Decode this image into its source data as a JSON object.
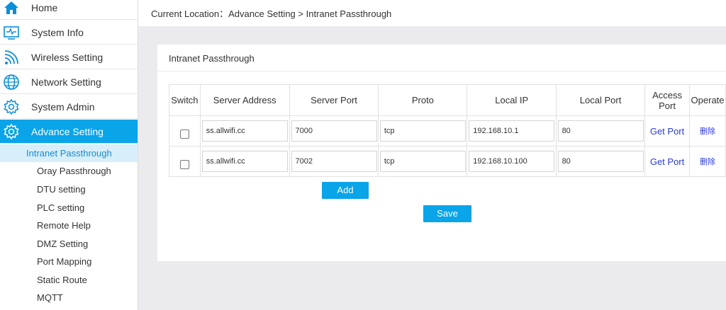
{
  "sidebar": {
    "items": [
      {
        "label": "Home",
        "icon": "home-icon"
      },
      {
        "label": "System Info",
        "icon": "monitor-icon"
      },
      {
        "label": "Wireless Setting",
        "icon": "wifi-icon"
      },
      {
        "label": "Network Setting",
        "icon": "globe-icon"
      },
      {
        "label": "System Admin",
        "icon": "gear-icon"
      },
      {
        "label": "Advance Setting",
        "icon": "gear-icon",
        "active": true
      }
    ],
    "sub_items": [
      {
        "label": "Intranet Passthrough",
        "active": true
      },
      {
        "label": "Oray Passthrough"
      },
      {
        "label": "DTU setting"
      },
      {
        "label": "PLC setting"
      },
      {
        "label": "Remote Help"
      },
      {
        "label": "DMZ Setting"
      },
      {
        "label": "Port Mapping"
      },
      {
        "label": "Static Route"
      },
      {
        "label": "MQTT"
      }
    ]
  },
  "breadcrumb": "Current Location：Advance Setting > Intranet Passthrough",
  "card": {
    "title": "Intranet Passthrough",
    "columns": {
      "switch": "Switch",
      "server_address": "Server Address",
      "server_port": "Server Port",
      "proto": "Proto",
      "local_ip": "Local IP",
      "local_port": "Local Port",
      "access_port_1": "Access",
      "access_port_2": "Port",
      "operate": "Operate"
    },
    "rows": [
      {
        "switch": false,
        "server_address": "ss.allwifi.cc",
        "server_port": "7000",
        "proto": "tcp",
        "local_ip": "192.168.10.1",
        "local_port": "80",
        "access": "Get Port",
        "operate": "删除"
      },
      {
        "switch": false,
        "server_address": "ss.allwifi.cc",
        "server_port": "7002",
        "proto": "tcp",
        "local_ip": "192.168.10.100",
        "local_port": "80",
        "access": "Get Port",
        "operate": "删除"
      }
    ],
    "add_label": "Add",
    "save_label": "Save"
  },
  "colors": {
    "accent": "#0aa4e8",
    "link": "#2a3bd6",
    "active_sub_bg": "#d7effb"
  }
}
